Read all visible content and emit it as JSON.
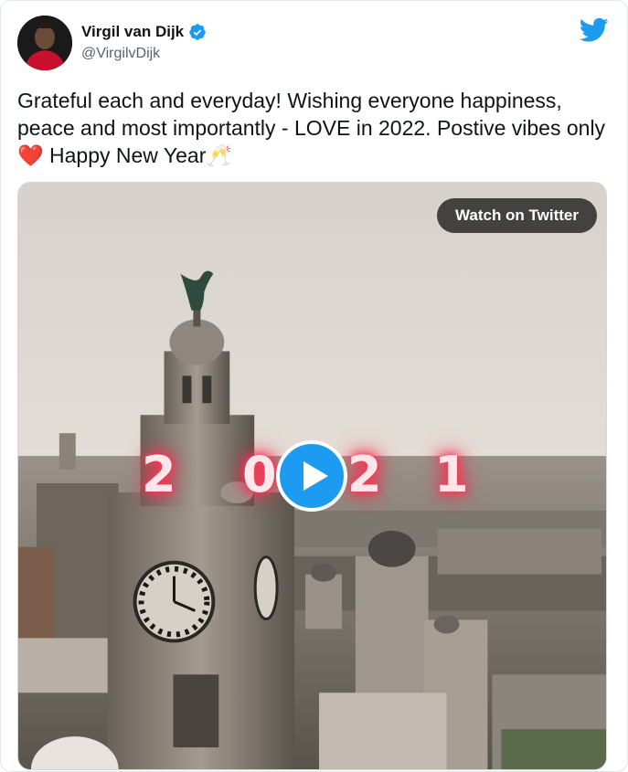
{
  "author": {
    "display_name": "Virgil van Dijk",
    "handle": "@VirgilvDijk",
    "verified_icon": "verified-badge-icon",
    "avatar_icon": "avatar"
  },
  "brand": {
    "logo_icon": "twitter-bird-icon",
    "color": "#1d9bf0"
  },
  "tweet": {
    "text_before_heart": "Grateful each and everyday! Wishing everyone happiness, peace and most importantly - LOVE in 2022. Postive vibes only ",
    "heart": "❤️",
    "text_after_heart": " Happy New Year",
    "cheers": "🥂"
  },
  "media": {
    "watch_label": "Watch on Twitter",
    "play_icon": "play-icon",
    "year_digits": [
      "2",
      "0",
      "2",
      "1"
    ],
    "accent_glow": "#ff2447"
  }
}
